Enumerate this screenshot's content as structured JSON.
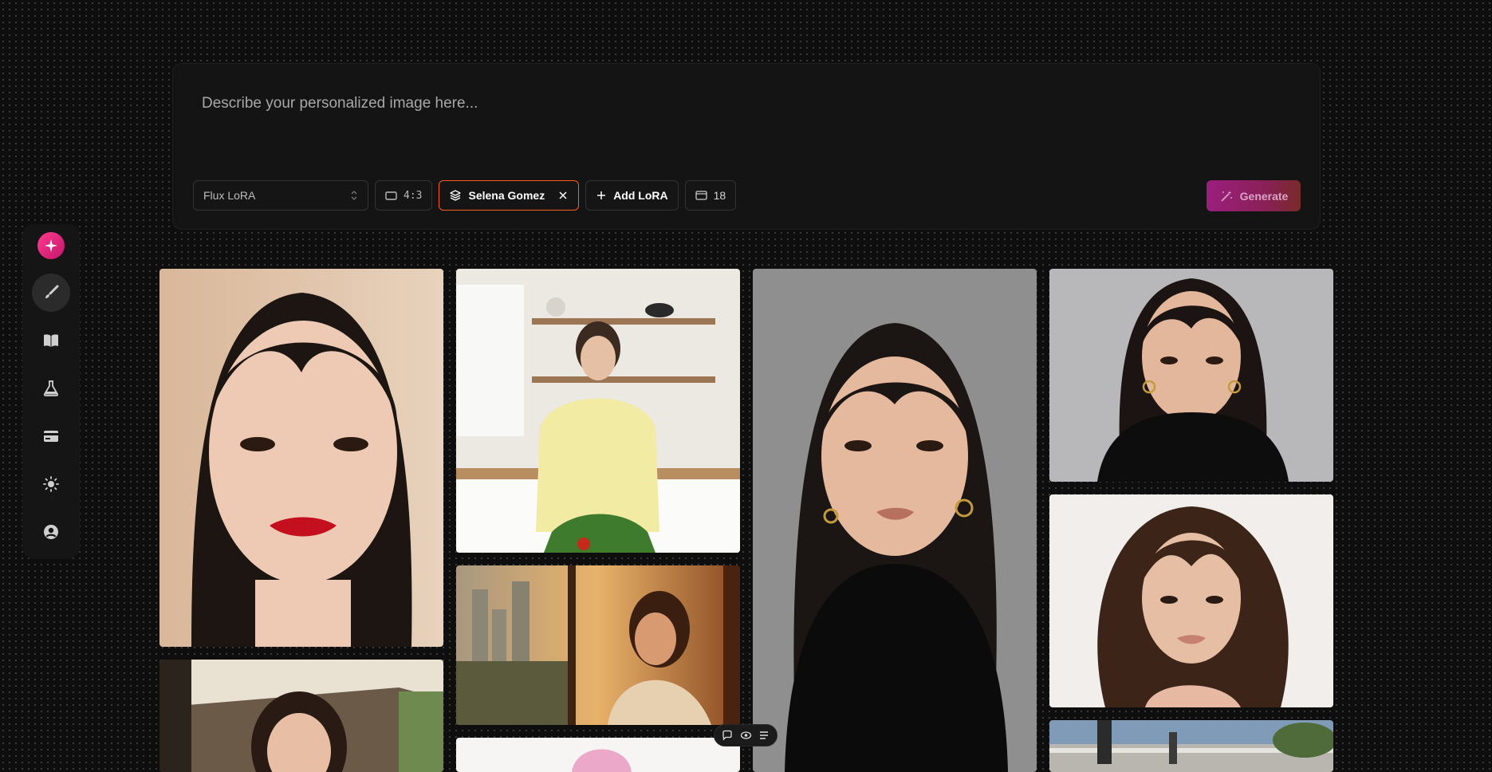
{
  "prompt": {
    "placeholder": "Describe your personalized image here..."
  },
  "controls": {
    "model": "Flux LoRA",
    "aspect_ratio": "4:3",
    "lora_name": "Selena Gomez",
    "add_lora_label": "Add LoRA",
    "image_count": "18",
    "generate_label": "Generate"
  },
  "sidebar": {
    "items": [
      {
        "name": "logo",
        "icon": "sparkle-icon"
      },
      {
        "name": "create",
        "icon": "brush-icon",
        "active": true
      },
      {
        "name": "library",
        "icon": "book-icon"
      },
      {
        "name": "lab",
        "icon": "flask-icon"
      },
      {
        "name": "billing",
        "icon": "credit-card-icon"
      },
      {
        "name": "theme",
        "icon": "sun-icon"
      },
      {
        "name": "account",
        "icon": "user-circle-icon"
      }
    ]
  },
  "gallery": {
    "images": [
      {
        "id": "close-up-red-lips"
      },
      {
        "id": "kitchen-yellow-cardigan"
      },
      {
        "id": "black-turtleneck-portrait"
      },
      {
        "id": "turtleneck-headshot"
      },
      {
        "id": "wavy-hair-portrait"
      },
      {
        "id": "cafe-awning"
      },
      {
        "id": "sunset-window-city"
      },
      {
        "id": "pink-object"
      },
      {
        "id": "outdoor-street"
      }
    ]
  },
  "colors": {
    "accent": "#ff3b8d",
    "lora_border": "#ff5a1f",
    "generate_start": "#9b1f7e"
  }
}
